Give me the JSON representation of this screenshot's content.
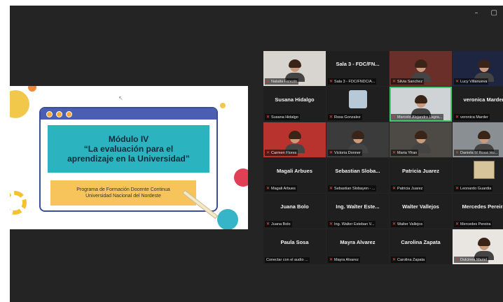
{
  "window": {
    "minimize": "–",
    "restore": "▢"
  },
  "slide": {
    "title": "Módulo IV",
    "subtitle_line1": "“La evaluación para el",
    "subtitle_line2": "aprendizaje en la Universidad”",
    "program_line1": "Programa de Formación Docente Continua",
    "program_line2": "Universidad Nacional del Nordeste"
  },
  "participants": [
    {
      "tag": "Natalia Ferezin",
      "kind": "video",
      "bg": "#d8d4cf"
    },
    {
      "big": "Sala 3 - FDC/FN...",
      "tag": "Sala 3 - FDC/FNDC/A...",
      "kind": "name"
    },
    {
      "tag": "Silvia Sanchez",
      "kind": "video",
      "bg": "#6b2f2a"
    },
    {
      "tag": "Lucy Villanueva",
      "kind": "video",
      "bg": "#1d2540"
    },
    {
      "big": "Susana Hidalgo",
      "tag": "Susana Hidalgo",
      "kind": "name"
    },
    {
      "tag": "Rosa Gonzalez",
      "kind": "avatar"
    },
    {
      "tag": "Marcelo Alejandro Lagra...",
      "kind": "video",
      "bg": "#cfd3d6",
      "active": true
    },
    {
      "big": "veronica Marder",
      "tag": "veronica Marder",
      "kind": "name"
    },
    {
      "tag": "Carmen Flores",
      "kind": "video",
      "bg": "#b8322e"
    },
    {
      "tag": "Victoria Donner",
      "kind": "video",
      "bg": "#3b3b3b"
    },
    {
      "tag": "Maria Yfran",
      "kind": "video",
      "bg": "#4d4a45"
    },
    {
      "tag": "Daniela M Rossi Ho...",
      "kind": "video",
      "bg": "#8a8f93"
    },
    {
      "big": "Magali Arbues",
      "tag": "Magali Arbues",
      "kind": "name"
    },
    {
      "big": "Sebastian Sloba...",
      "tag": "Sebastian Slobayen - ...",
      "kind": "name"
    },
    {
      "big": "Patricia Juarez",
      "tag": "Patricia Juarez",
      "kind": "name"
    },
    {
      "tag": "Leonardo Guardia",
      "kind": "map"
    },
    {
      "big": "Juana Bolo",
      "tag": "Juana Bolo",
      "kind": "name"
    },
    {
      "big": "Ing. Walter Este...",
      "tag": "Ing. Walter Esteban V...",
      "kind": "name"
    },
    {
      "big": "Walter Vallejos",
      "tag": "Walter Vallejos",
      "kind": "name"
    },
    {
      "big": "Mercedes Pereira",
      "tag": "Mercedes Pereira",
      "kind": "name"
    },
    {
      "big": "Paula Sosa",
      "tag": "Conectar con el audio ...",
      "kind": "name",
      "nomic": true
    },
    {
      "big": "Mayra Alvarez",
      "tag": "Mayra Alvarez",
      "kind": "name"
    },
    {
      "big": "Carolina Zapata",
      "tag": "Carolina Zapata",
      "kind": "name"
    },
    {
      "tag": "Dulcinea Mariel",
      "kind": "video",
      "bg": "#e9e6e2"
    }
  ]
}
